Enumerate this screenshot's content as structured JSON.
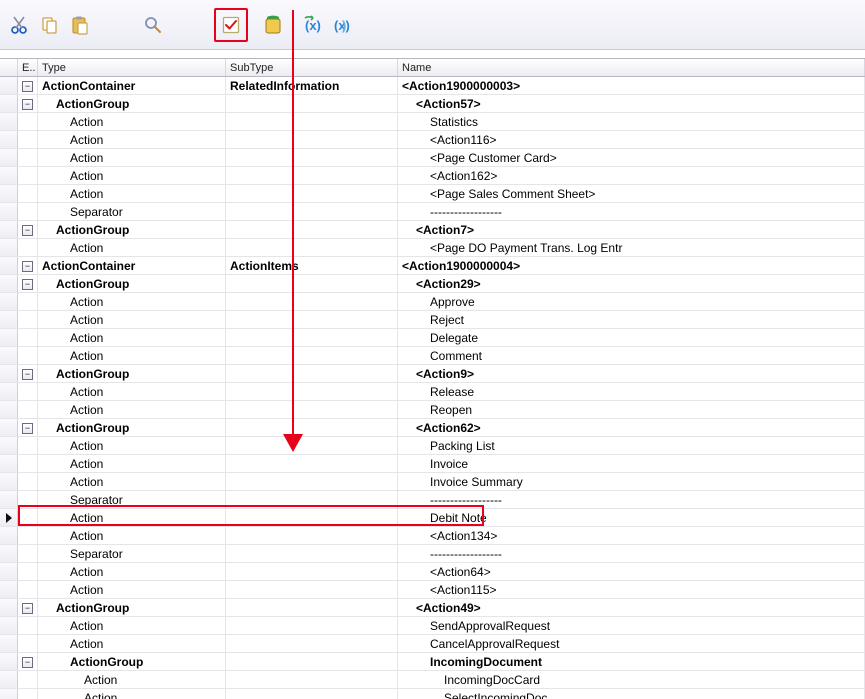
{
  "toolbar": {
    "cut": "cut-icon",
    "copy": "copy-icon",
    "paste": "paste-icon",
    "search": "search-icon",
    "check": "check-icon",
    "runtime": "runtime-icon",
    "globals1": "globals-icon",
    "globals2": "globals2-icon"
  },
  "columns": {
    "e": "E..",
    "type": "Type",
    "subtype": "SubType",
    "name": "Name"
  },
  "rows": [
    {
      "indent": 0,
      "expand": true,
      "bold": true,
      "type": "ActionContainer",
      "subtype": "RelatedInformation",
      "name": "<Action1900000003>"
    },
    {
      "indent": 1,
      "expand": true,
      "bold": true,
      "type": "ActionGroup",
      "subtype": "",
      "name": "<Action57>"
    },
    {
      "indent": 2,
      "type": "Action",
      "subtype": "",
      "name": "Statistics"
    },
    {
      "indent": 2,
      "type": "Action",
      "subtype": "",
      "name": "<Action116>"
    },
    {
      "indent": 2,
      "type": "Action",
      "subtype": "",
      "name": "<Page Customer Card>"
    },
    {
      "indent": 2,
      "type": "Action",
      "subtype": "",
      "name": "<Action162>"
    },
    {
      "indent": 2,
      "type": "Action",
      "subtype": "",
      "name": "<Page Sales Comment Sheet>"
    },
    {
      "indent": 2,
      "type": "Separator",
      "subtype": "",
      "name": "------------------"
    },
    {
      "indent": 1,
      "expand": true,
      "bold": true,
      "type": "ActionGroup",
      "subtype": "",
      "name": "<Action7>"
    },
    {
      "indent": 2,
      "type": "Action",
      "subtype": "",
      "name": "<Page DO Payment Trans. Log Entr"
    },
    {
      "indent": 0,
      "expand": true,
      "bold": true,
      "type": "ActionContainer",
      "subtype": "ActionItems",
      "name": "<Action1900000004>"
    },
    {
      "indent": 1,
      "expand": true,
      "bold": true,
      "type": "ActionGroup",
      "subtype": "",
      "name": "<Action29>"
    },
    {
      "indent": 2,
      "type": "Action",
      "subtype": "",
      "name": "Approve"
    },
    {
      "indent": 2,
      "type": "Action",
      "subtype": "",
      "name": "Reject"
    },
    {
      "indent": 2,
      "type": "Action",
      "subtype": "",
      "name": "Delegate"
    },
    {
      "indent": 2,
      "type": "Action",
      "subtype": "",
      "name": "Comment"
    },
    {
      "indent": 1,
      "expand": true,
      "bold": true,
      "type": "ActionGroup",
      "subtype": "",
      "name": "<Action9>"
    },
    {
      "indent": 2,
      "type": "Action",
      "subtype": "",
      "name": "Release"
    },
    {
      "indent": 2,
      "type": "Action",
      "subtype": "",
      "name": "Reopen"
    },
    {
      "indent": 1,
      "expand": true,
      "bold": true,
      "type": "ActionGroup",
      "subtype": "",
      "name": "<Action62>"
    },
    {
      "indent": 2,
      "type": "Action",
      "subtype": "",
      "name": "Packing List"
    },
    {
      "indent": 2,
      "type": "Action",
      "subtype": "",
      "name": "Invoice"
    },
    {
      "indent": 2,
      "type": "Action",
      "subtype": "",
      "name": "Invoice Summary"
    },
    {
      "indent": 2,
      "type": "Separator",
      "subtype": "",
      "name": "------------------"
    },
    {
      "indent": 2,
      "type": "Action",
      "subtype": "",
      "name": "Debit Note",
      "selected": true,
      "marker": true
    },
    {
      "indent": 2,
      "type": "Action",
      "subtype": "",
      "name": "<Action134>"
    },
    {
      "indent": 2,
      "type": "Separator",
      "subtype": "",
      "name": "------------------"
    },
    {
      "indent": 2,
      "type": "Action",
      "subtype": "",
      "name": "<Action64>"
    },
    {
      "indent": 2,
      "type": "Action",
      "subtype": "",
      "name": "<Action115>"
    },
    {
      "indent": 1,
      "expand": true,
      "bold": true,
      "type": "ActionGroup",
      "subtype": "",
      "name": "<Action49>"
    },
    {
      "indent": 2,
      "type": "Action",
      "subtype": "",
      "name": "SendApprovalRequest"
    },
    {
      "indent": 2,
      "type": "Action",
      "subtype": "",
      "name": "CancelApprovalRequest"
    },
    {
      "indent": 2,
      "expand": true,
      "bold": true,
      "type": "ActionGroup",
      "subtype": "",
      "name": "IncomingDocument"
    },
    {
      "indent": 3,
      "type": "Action",
      "subtype": "",
      "name": "IncomingDocCard"
    },
    {
      "indent": 3,
      "type": "Action",
      "subtype": "",
      "name": "SelectIncomingDoc"
    }
  ],
  "annotation": {
    "selectedRowIndex": 24
  }
}
